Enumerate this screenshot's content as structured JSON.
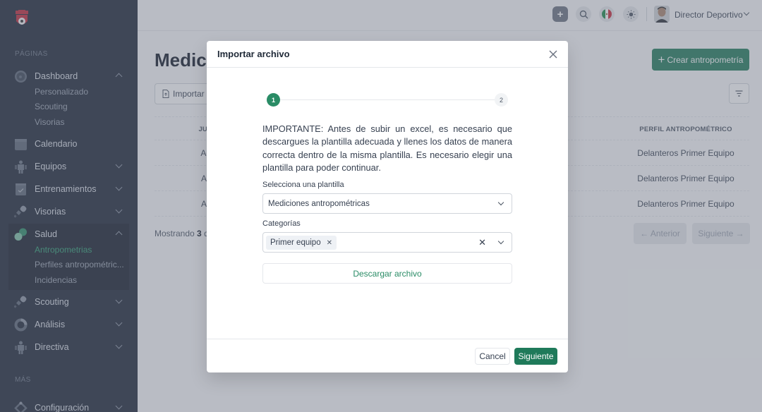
{
  "sidebar": {
    "sections": {
      "pages": "PÁGINAS",
      "more": "MÁS"
    },
    "items": [
      {
        "label": "Dashboard",
        "icon": "gauge-icon",
        "expanded": true,
        "children": [
          "Personalizado",
          "Scouting",
          "Visorias"
        ]
      },
      {
        "label": "Calendario",
        "icon": "calendar-icon"
      },
      {
        "label": "Equipos",
        "icon": "team-icon",
        "expanded": false
      },
      {
        "label": "Entrenamientos",
        "icon": "clipboard-check-icon",
        "expanded": false
      },
      {
        "label": "Visorias",
        "icon": "binoculars-icon",
        "expanded": false
      },
      {
        "label": "Salud",
        "icon": "health-icon",
        "expanded": true,
        "children": [
          "Antropometrias",
          "Perfiles antropométric...",
          "Incidencias"
        ],
        "active_child": "Antropometrias"
      },
      {
        "label": "Scouting",
        "icon": "binoculars-icon",
        "expanded": false
      },
      {
        "label": "Análisis",
        "icon": "donut-chart-icon",
        "expanded": false
      },
      {
        "label": "Directiva",
        "icon": "team-icon",
        "expanded": false
      },
      {
        "label": "Configuración",
        "icon": "settings-diamond-icon",
        "expanded": false
      }
    ]
  },
  "topbar": {
    "user_name": "Director Deportivo",
    "icons": [
      "plus-icon",
      "search-icon",
      "mexico-flag-icon",
      "sun-icon"
    ]
  },
  "page": {
    "title": "Medici",
    "create_button": "Crear antropometría",
    "import_button": "Importar a",
    "table": {
      "headers": [
        "JU",
        "PERFIL ANTROPOMÉTRICO"
      ],
      "rows": [
        [
          "Adrián",
          "Delanteros Primer Equipo"
        ],
        [
          "Antoni",
          "Delanteros Primer Equipo"
        ],
        [
          "Antoni",
          "Delanteros Primer Equipo"
        ]
      ]
    },
    "showing_prefix": "Mostrando",
    "showing_count": "3",
    "showing_suffix": "d",
    "pagination": {
      "prev": "← Anterior",
      "next": "Siguiente →"
    }
  },
  "modal": {
    "title": "Importar archivo",
    "steps": [
      "1",
      "2"
    ],
    "current_step": 1,
    "notice": "IMPORTANTE: Antes de subir un excel, es necesario que descargues la plantilla adecuada y llenes los datos de manera correcta dentro de la misma plantilla. Es necesario elegir una plantilla para poder continuar.",
    "template_label": "Selecciona una plantilla",
    "template_value": "Mediciones antropométricas",
    "categories_label": "Categorías",
    "categories_selected": [
      "Primer equipo"
    ],
    "download_button": "Descargar archivo",
    "cancel_button": "Cancel",
    "next_button": "Siguiente"
  },
  "colors": {
    "primary": "#1f7a5a",
    "step_active": "#2a8c66",
    "sidebar_bg": "#1c2536",
    "active_link": "#2f9e74"
  }
}
